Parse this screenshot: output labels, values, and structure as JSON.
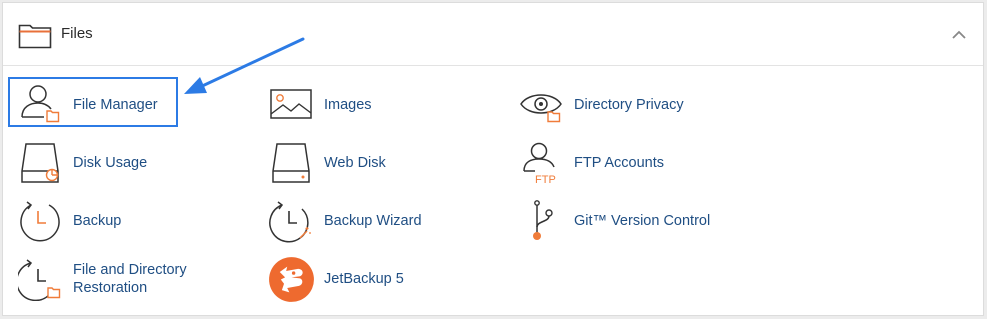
{
  "panel": {
    "title": "Files",
    "header_icon": "folder-icon",
    "toggle_icon": "chevron-up-icon"
  },
  "colors": {
    "link": "#1f4e83",
    "accent_orange": "#f07c3a",
    "highlight": "#2c7be5"
  },
  "items": [
    {
      "label": "File Manager",
      "icon": "file-manager-icon"
    },
    {
      "label": "Images",
      "icon": "images-icon"
    },
    {
      "label": "Directory Privacy",
      "icon": "directory-privacy-icon"
    },
    {
      "label": "Disk Usage",
      "icon": "disk-usage-icon"
    },
    {
      "label": "Web Disk",
      "icon": "web-disk-icon"
    },
    {
      "label": "FTP Accounts",
      "icon": "ftp-accounts-icon"
    },
    {
      "label": "Backup",
      "icon": "backup-icon"
    },
    {
      "label": "Backup Wizard",
      "icon": "backup-wizard-icon"
    },
    {
      "label": "Git™ Version Control",
      "icon": "git-version-control-icon"
    },
    {
      "label": "File and Directory Restoration",
      "icon": "file-directory-restoration-icon"
    },
    {
      "label": "JetBackup 5",
      "icon": "jetbackup-icon"
    }
  ],
  "ftp_badge_text": "FTP"
}
